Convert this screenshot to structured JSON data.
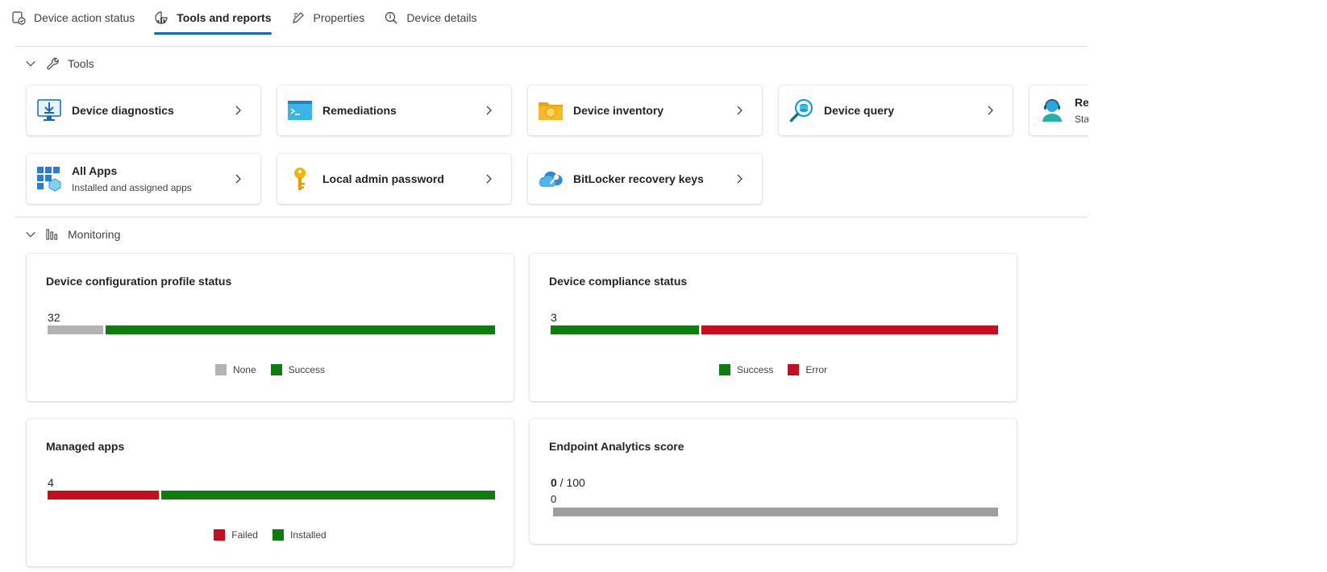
{
  "tabs": [
    {
      "label": "Device action status",
      "icon": "device-check-icon"
    },
    {
      "label": "Tools and reports",
      "icon": "report-icon",
      "active": true
    },
    {
      "label": "Properties",
      "icon": "edit-icon"
    },
    {
      "label": "Device details",
      "icon": "search-info-icon"
    }
  ],
  "sections": {
    "tools": {
      "label": "Tools",
      "icon": "wrench-icon"
    },
    "monitoring": {
      "label": "Monitoring",
      "icon": "chart-icon"
    }
  },
  "tools": [
    {
      "title": "Device diagnostics",
      "subtitle": "",
      "icon": "diagnostics-icon"
    },
    {
      "title": "Remediations",
      "subtitle": "",
      "icon": "terminal-icon"
    },
    {
      "title": "Device inventory",
      "subtitle": "",
      "icon": "inventory-icon"
    },
    {
      "title": "Device query",
      "subtitle": "",
      "icon": "query-icon"
    },
    {
      "title": "Ren",
      "subtitle": "Start",
      "icon": "remote-help-icon"
    },
    {
      "title": "All Apps",
      "subtitle": "Installed and assigned apps",
      "icon": "apps-grid-icon"
    },
    {
      "title": "Local admin password",
      "subtitle": "",
      "icon": "key-icon"
    },
    {
      "title": "BitLocker recovery keys",
      "subtitle": "",
      "icon": "cloud-key-icon"
    }
  ],
  "monitoring": {
    "config_profile": {
      "title": "Device configuration profile status",
      "count": "32",
      "segments": [
        {
          "label": "None",
          "fraction": 0.125,
          "color": "#b3b3b3"
        },
        {
          "label": "Success",
          "fraction": 0.875,
          "color": "#107c10"
        }
      ],
      "legend": [
        {
          "label": "None",
          "color": "#b3b3b3"
        },
        {
          "label": "Success",
          "color": "#107c10"
        }
      ]
    },
    "compliance": {
      "title": "Device compliance status",
      "count": "3",
      "segments": [
        {
          "label": "Success",
          "fraction": 0.333,
          "color": "#107c10"
        },
        {
          "label": "Error",
          "fraction": 0.667,
          "color": "#c50f1f"
        }
      ],
      "legend": [
        {
          "label": "Success",
          "color": "#107c10"
        },
        {
          "label": "Error",
          "color": "#c50f1f"
        }
      ]
    },
    "managed_apps": {
      "title": "Managed apps",
      "count": "4",
      "segments": [
        {
          "label": "Failed",
          "fraction": 0.25,
          "color": "#c50f1f"
        },
        {
          "label": "Installed",
          "fraction": 0.75,
          "color": "#107c10"
        }
      ],
      "legend": [
        {
          "label": "Failed",
          "color": "#c50f1f"
        },
        {
          "label": "Installed",
          "color": "#107c10"
        }
      ]
    },
    "analytics": {
      "title": "Endpoint Analytics score",
      "score": "0",
      "max": "100",
      "separator": " / ",
      "value": "0",
      "bar_color": "#9e9e9e"
    }
  }
}
